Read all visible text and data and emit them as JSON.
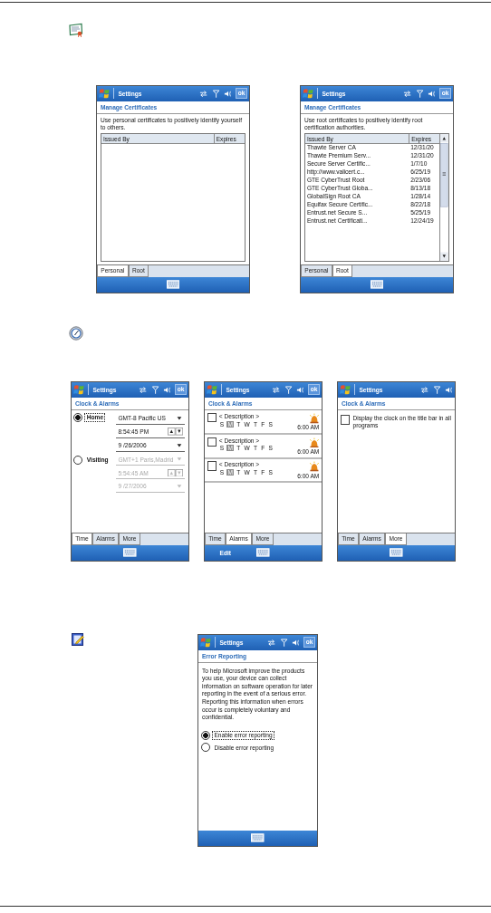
{
  "sections": [
    {
      "screens": [
        {
          "kind": "certificates",
          "title": "Settings",
          "ok": "ok",
          "heading": "Manage Certificates",
          "description": "Use personal certificates to positively identify yourself to others.",
          "columns": [
            "Issued By",
            "Expires"
          ],
          "tabs": [
            {
              "label": "Personal",
              "selected": true
            },
            {
              "label": "Root",
              "selected": false
            }
          ]
        },
        {
          "kind": "certificates",
          "title": "Settings",
          "ok": "ok",
          "heading": "Manage Certificates",
          "description": "Use root certificates to positively identify root certification authorities.",
          "columns": [
            "Issued By",
            "Expires"
          ],
          "rows": [
            [
              "Thawte Server CA",
              "12/31/20"
            ],
            [
              "Thawte Premium Serv...",
              "12/31/20"
            ],
            [
              "Secure Server Certific...",
              "1/7/10"
            ],
            [
              "http://www.valicert.c...",
              "6/25/19"
            ],
            [
              "GTE CyberTrust Root",
              "2/23/06"
            ],
            [
              "GTE CyberTrust Globa...",
              "8/13/18"
            ],
            [
              "GlobalSign Root CA",
              "1/28/14"
            ],
            [
              "Equifax Secure Certific...",
              "8/22/18"
            ],
            [
              "Entrust.net Secure S...",
              "5/25/19"
            ],
            [
              "Entrust.net Certificati...",
              "12/24/19"
            ]
          ],
          "tabs": [
            {
              "label": "Personal",
              "selected": false
            },
            {
              "label": "Root",
              "selected": true
            }
          ]
        }
      ]
    },
    {
      "screens": [
        {
          "kind": "clock_time",
          "title": "Settings",
          "ok": "ok",
          "heading": "Clock & Alarms",
          "options": [
            {
              "label": "Home",
              "selected": true,
              "fields": [
                {
                  "kind": "dropdown",
                  "value": "GMT-8 Pacific US",
                  "disabled": false
                },
                {
                  "kind": "spinner",
                  "value": "8:54:45 PM",
                  "disabled": false
                },
                {
                  "kind": "dropdown",
                  "value": "9 /26/2006",
                  "disabled": false
                }
              ]
            },
            {
              "label": "Visiting",
              "selected": false,
              "fields": [
                {
                  "kind": "dropdown",
                  "value": "GMT+1 Paris,Madrid",
                  "disabled": true
                },
                {
                  "kind": "spinner",
                  "value": "5:54:45 AM",
                  "disabled": true
                },
                {
                  "kind": "dropdown",
                  "value": "9 /27/2006",
                  "disabled": true
                }
              ]
            }
          ],
          "tabs": [
            {
              "label": "Time",
              "selected": true
            },
            {
              "label": "Alarms",
              "selected": false
            },
            {
              "label": "More",
              "selected": false
            }
          ]
        },
        {
          "kind": "alarms",
          "title": "Settings",
          "ok": "ok",
          "heading": "Clock & Alarms",
          "alarms": [
            {
              "checked": false,
              "description": "< Description >",
              "time": "6:00 AM",
              "days": [
                {
                  "label": "S",
                  "selected": false
                },
                {
                  "label": "M",
                  "selected": true
                },
                {
                  "label": "T",
                  "selected": false
                },
                {
                  "label": "W",
                  "selected": false
                },
                {
                  "label": "T",
                  "selected": false
                },
                {
                  "label": "F",
                  "selected": false
                },
                {
                  "label": "S",
                  "selected": false
                }
              ]
            },
            {
              "checked": false,
              "description": "< Description >",
              "time": "6:00 AM",
              "days": [
                {
                  "label": "S",
                  "selected": false
                },
                {
                  "label": "M",
                  "selected": true
                },
                {
                  "label": "T",
                  "selected": false
                },
                {
                  "label": "W",
                  "selected": false
                },
                {
                  "label": "T",
                  "selected": false
                },
                {
                  "label": "F",
                  "selected": false
                },
                {
                  "label": "S",
                  "selected": false
                }
              ]
            },
            {
              "checked": false,
              "description": "< Description >",
              "time": "6:00 AM",
              "days": [
                {
                  "label": "S",
                  "selected": false
                },
                {
                  "label": "M",
                  "selected": true
                },
                {
                  "label": "T",
                  "selected": false
                },
                {
                  "label": "W",
                  "selected": false
                },
                {
                  "label": "T",
                  "selected": false
                },
                {
                  "label": "F",
                  "selected": false
                },
                {
                  "label": "S",
                  "selected": false
                }
              ]
            }
          ],
          "tabs": [
            {
              "label": "Time",
              "selected": false
            },
            {
              "label": "Alarms",
              "selected": true
            },
            {
              "label": "More",
              "selected": false
            }
          ],
          "menu": "Edit"
        },
        {
          "kind": "clock_more",
          "title": "Settings",
          "heading": "Clock & Alarms",
          "checkbox": {
            "label": "Display the clock on the title bar in all programs",
            "checked": false
          },
          "tabs": [
            {
              "label": "Time",
              "selected": false
            },
            {
              "label": "Alarms",
              "selected": false
            },
            {
              "label": "More",
              "selected": true
            }
          ]
        }
      ]
    },
    {
      "screens": [
        {
          "kind": "error_reporting",
          "title": "Settings",
          "ok": "ok",
          "heading": "Error Reporting",
          "description": "To help Microsoft improve the products you use, your device can collect information on software operation for later reporting in the event of a serious error. Reporting this information when errors occur is completely voluntary and confidential.",
          "options": [
            {
              "label": "Enable error reporting",
              "selected": true
            },
            {
              "label": "Disable error reporting",
              "selected": false
            }
          ]
        }
      ]
    }
  ]
}
